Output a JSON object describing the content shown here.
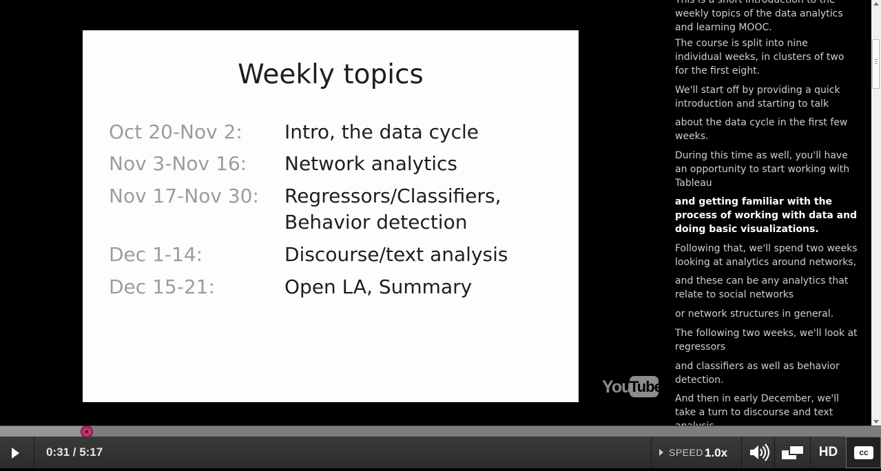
{
  "slide": {
    "title": "Weekly topics",
    "rows": [
      {
        "date": "Oct 20-Nov 2:",
        "topic": "Intro, the data cycle"
      },
      {
        "date": "Nov 3-Nov 16:",
        "topic": "Network analytics"
      },
      {
        "date": "Nov 17-Nov 30:",
        "topic": "Regressors/Classifiers,",
        "topic2": "Behavior detection"
      },
      {
        "date": "Dec 1-14:",
        "topic": "Discourse/text analysis"
      },
      {
        "date": "Dec 15-21:",
        "topic": "Open LA, Summary"
      }
    ]
  },
  "watermark": {
    "you": "You",
    "tube": "Tube"
  },
  "transcript": {
    "lines": [
      {
        "text": "This is a short introduction to the weekly topics of the data analytics and learning MOOC.",
        "current": false
      },
      {
        "text": "The course is split into nine individual weeks, in clusters of two for the first eight.",
        "current": false
      },
      {
        "text": "We'll start off by providing a quick introduction and starting to talk",
        "current": false
      },
      {
        "text": "about the data cycle in the first few weeks.",
        "current": false
      },
      {
        "text": "During this time as well, you'll have an opportunity to start working with Tableau",
        "current": false
      },
      {
        "text": "and getting familiar with the process of working with data and doing basic visualizations.",
        "current": true
      },
      {
        "text": "Following that, we'll spend two weeks looking at analytics around networks,",
        "current": false
      },
      {
        "text": "and these can be any analytics that relate to social networks",
        "current": false
      },
      {
        "text": "or network structures in general.",
        "current": false
      },
      {
        "text": "The following two weeks, we'll look at regressors",
        "current": false
      },
      {
        "text": "and classifiers as well as behavior detection.",
        "current": false
      },
      {
        "text": "And then in early December, we'll take a turn to discourse and text analysis,",
        "current": false
      }
    ]
  },
  "player": {
    "time": "0:31 / 5:17",
    "progress_fraction": 0.098,
    "speed_label": "SPEED",
    "speed_value": "1.0x",
    "hd_label": "HD",
    "cc_label": "cc",
    "accent_color": "#c7306e"
  }
}
